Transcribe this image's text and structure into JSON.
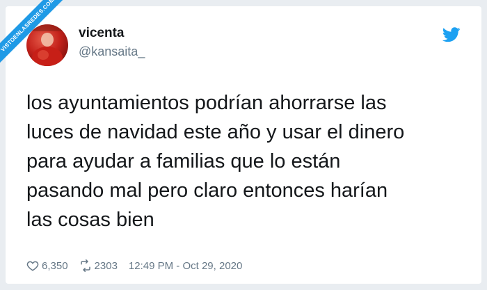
{
  "watermark": {
    "text": "VISTOENLASREDES.COM"
  },
  "tweet": {
    "display_name": "vicenta",
    "handle": "@kansaita_",
    "text": "los ayuntamientos podrían ahorrarse las\nluces de navidad este año y usar el dinero\npara ayudar a familias que lo están\npasando mal pero claro entonces harían\nlas cosas bien",
    "likes": "6,350",
    "retweets": "2303",
    "timestamp": "12:49 PM - Oct 29, 2020"
  },
  "icons": {
    "brand": "twitter-bird-icon",
    "like": "heart-icon",
    "retweet": "retweet-icon"
  },
  "colors": {
    "brand": "#1da1f2",
    "text": "#14171a",
    "secondary": "#657786",
    "background": "#e9edf1",
    "watermark": "#1f9ae6"
  }
}
